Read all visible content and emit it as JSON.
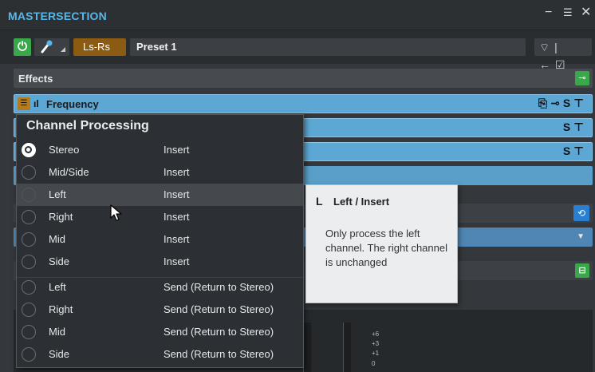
{
  "window": {
    "title": "MASTERSECTION",
    "controls": {
      "minimize": "−",
      "menu": "☰",
      "close": "✕"
    }
  },
  "toolbar": {
    "power_glyph": "⏻",
    "channel_selector": "Ls-Rs",
    "preset": "Preset 1",
    "right_icons": "⌔|←☑"
  },
  "effects": {
    "header": "Effects",
    "slots": [
      {
        "name": "Frequency",
        "icons": "⎘⊸S⊤",
        "state": "active"
      },
      {
        "name": "",
        "icons": "S⊤",
        "state": "active"
      },
      {
        "name": "",
        "icons": "S⊤",
        "state": "active"
      },
      {
        "name": "",
        "icons": "",
        "state": "empty"
      }
    ]
  },
  "channel_menu": {
    "title": "Channel Processing",
    "items": [
      {
        "label": "Stereo",
        "mode": "Insert",
        "selected": true
      },
      {
        "label": "Mid/Side",
        "mode": "Insert",
        "selected": false
      },
      {
        "label": "Left",
        "mode": "Insert",
        "selected": false,
        "hover": true
      },
      {
        "label": "Right",
        "mode": "Insert",
        "selected": false
      },
      {
        "label": "Mid",
        "mode": "Insert",
        "selected": false
      },
      {
        "label": "Side",
        "mode": "Insert",
        "selected": false
      },
      {
        "label": "Left",
        "mode": "Send (Return to Stereo)",
        "selected": false
      },
      {
        "label": "Right",
        "mode": "Send (Return to Stereo)",
        "selected": false
      },
      {
        "label": "Mid",
        "mode": "Send (Return to Stereo)",
        "selected": false
      },
      {
        "label": "Side",
        "mode": "Send (Return to Stereo)",
        "selected": false
      }
    ]
  },
  "tooltip": {
    "key": "L",
    "heading": "Left / Insert",
    "description": "Only process the left channel. The right channel is unchanged"
  },
  "meter_scale": [
    "+6",
    "+3",
    "+1",
    "0"
  ],
  "colors": {
    "accent_blue": "#57b7e8",
    "slot_blue": "#5da7d4",
    "green": "#3aa84a",
    "orange": "#8b5a13"
  }
}
